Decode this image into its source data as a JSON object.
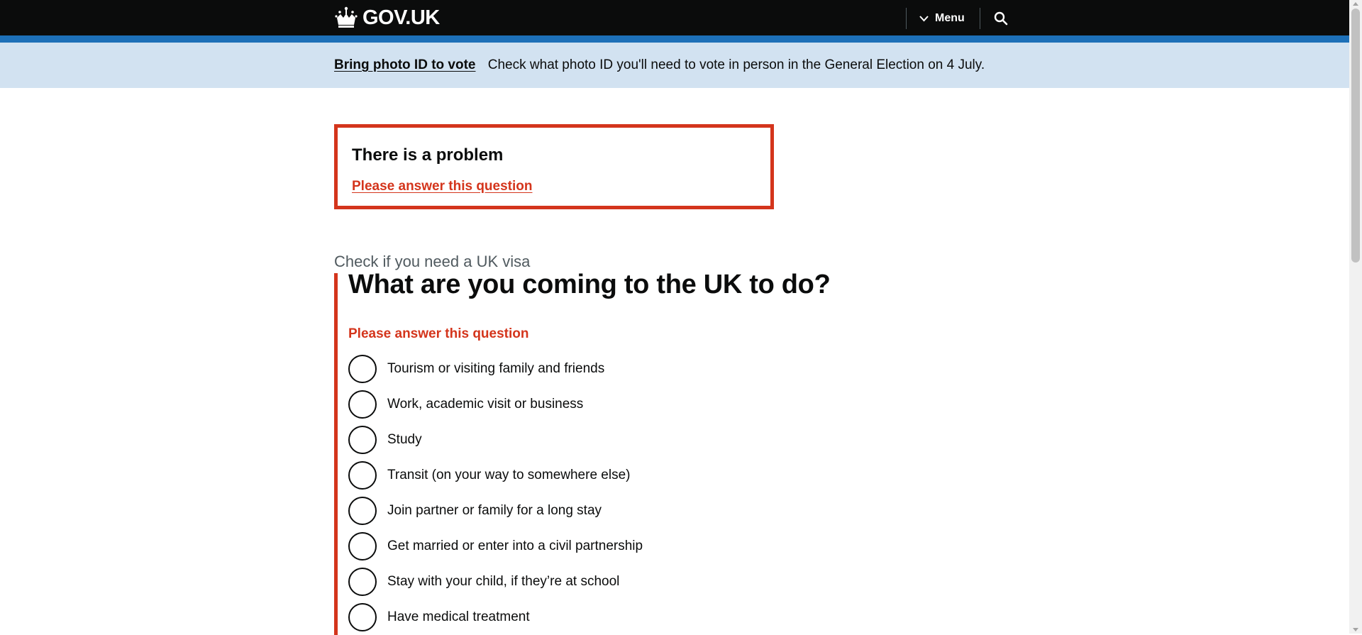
{
  "header": {
    "logo_text": "GOV.UK",
    "menu_label": "Menu",
    "search_icon": "search-icon"
  },
  "notice": {
    "link_text": "Bring photo ID to vote",
    "message": "Check what photo ID you'll need to vote in person in the General Election on 4 July."
  },
  "error_summary": {
    "title": "There is a problem",
    "link_text": "Please answer this question"
  },
  "form": {
    "caption": "Check if you need a UK visa",
    "question": "What are you coming to the UK to do?",
    "error_message": "Please answer this question",
    "options": [
      "Tourism or visiting family and friends",
      "Work, academic visit or business",
      "Study",
      "Transit (on your way to somewhere else)",
      "Join partner or family for a long stay",
      "Get married or enter into a civil partnership",
      "Stay with your child, if they’re at school",
      "Have medical treatment"
    ]
  },
  "colors": {
    "header_bg": "#0b0c0c",
    "brand_blue": "#1d70b8",
    "notice_bg": "#d2e2f1",
    "error_red": "#d4351c"
  }
}
